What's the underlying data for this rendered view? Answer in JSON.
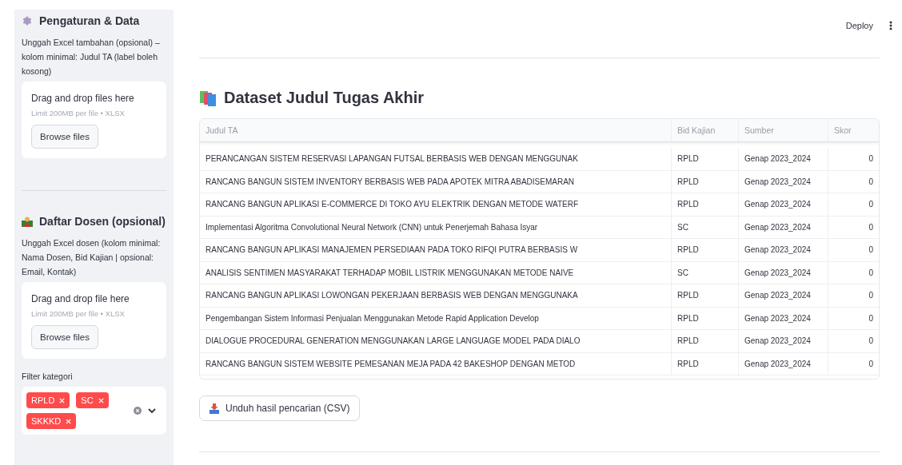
{
  "header": {
    "deploy": "Deploy"
  },
  "sidebar": {
    "sections": [
      {
        "title": "Pengaturan & Data",
        "description": "Unggah Excel tambahan (opsional) – kolom minimal: Judul TA (label boleh kosong)",
        "uploader": {
          "prompt": "Drag and drop files here",
          "limit": "Limit 200MB per file • XLSX",
          "button": "Browse files"
        }
      },
      {
        "title": "Daftar Dosen (opsional)",
        "description": "Unggah Excel dosen (kolom minimal: Nama Dosen, Bid Kajian | opsional: Email, Kontak)",
        "uploader": {
          "prompt": "Drag and drop file here",
          "limit": "Limit 200MB per file • XLSX",
          "button": "Browse files"
        }
      }
    ],
    "filter": {
      "label": "Filter kategori",
      "tags": [
        "RPLD",
        "SC",
        "SKKKD"
      ]
    }
  },
  "main": {
    "title": "Dataset Judul Tugas Akhir",
    "table": {
      "columns": [
        "Judul TA",
        "Bid Kajian",
        "Sumber",
        "Skor"
      ],
      "rows": [
        [
          "PERANCANGAN SISTEM RESERVASI LAPANGAN FUTSAL BERBASIS WEB DENGAN MENGGUNAK",
          "RPLD",
          "Genap 2023_2024",
          "0"
        ],
        [
          "RANCANG BANGUN SISTEM INVENTORY BERBASIS WEB PADA APOTEK MITRA ABADISEMARAN",
          "RPLD",
          "Genap 2023_2024",
          "0"
        ],
        [
          "RANCANG BANGUN APLIKASI E-COMMERCE DI TOKO AYU ELEKTRIK DENGAN METODE WATERF",
          "RPLD",
          "Genap 2023_2024",
          "0"
        ],
        [
          "Implementasi Algoritma Convolutional Neural Network (CNN) untuk Penerjemah Bahasa Isyar",
          "SC",
          "Genap 2023_2024",
          "0"
        ],
        [
          "RANCANG BANGUN APLIKASI MANAJEMEN PERSEDIAAN PADA TOKO RIFQI PUTRA BERBASIS W",
          "RPLD",
          "Genap 2023_2024",
          "0"
        ],
        [
          "ANALISIS SENTIMEN MASYARAKAT TERHADAP MOBIL LISTRIK MENGGUNAKAN METODE NAIVE",
          "SC",
          "Genap 2023_2024",
          "0"
        ],
        [
          "RANCANG BANGUN APLIKASI LOWONGAN PEKERJAAN BERBASIS WEB DENGAN MENGGUNAKA",
          "RPLD",
          "Genap 2023_2024",
          "0"
        ],
        [
          "Pengembangan Sistem Informasi Penjualan Menggunakan Metode Rapid Application Develop",
          "RPLD",
          "Genap 2023_2024",
          "0"
        ],
        [
          "DIALOGUE PROCEDURAL GENERATION MENGGUNAKAN LARGE LANGUAGE MODEL PADA DIALO",
          "RPLD",
          "Genap 2023_2024",
          "0"
        ],
        [
          "RANCANG BANGUN SISTEM WEBSITE PEMESANAN MEJA PADA 42 BAKESHOP DENGAN METOD",
          "RPLD",
          "Genap 2023_2024",
          "0"
        ]
      ]
    },
    "download_button": "Unduh hasil pencarian (CSV)"
  }
}
